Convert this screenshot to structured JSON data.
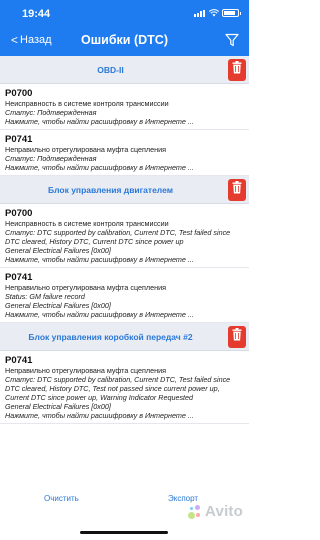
{
  "status_bar": {
    "time": "19:44"
  },
  "nav": {
    "back_label": "Назад",
    "title": "Ошибки (DTC)",
    "filter_icon": "filter-funnel-icon",
    "color": "#1e7cf0"
  },
  "sections": [
    {
      "title": "OBD-II",
      "items": [
        {
          "code": "P0700",
          "desc": "Неисправность в системе контроля трансмиссии",
          "lines": [
            "Статус: Подтвержденная",
            "Нажмите, чтобы найти расшифровку в Интернете ..."
          ]
        },
        {
          "code": "P0741",
          "desc": "Неправильно отрегулирована муфта сцепления",
          "lines": [
            "Статус: Подтвержденная",
            "Нажмите, чтобы найти расшифровку в Интернете ..."
          ]
        }
      ]
    },
    {
      "title": "Блок управления двигателем",
      "items": [
        {
          "code": "P0700",
          "desc": "Неисправность в системе контроля трансмиссии",
          "lines": [
            "Статус: DTC supported by calibration, Current DTC, Test failed since",
            "DTC cleared, History DTC, Current DTC since power up",
            "General Electrical Failures [0x00]",
            "Нажмите, чтобы найти расшифровку в Интернете ..."
          ]
        },
        {
          "code": "P0741",
          "desc": "Неправильно отрегулирована муфта сцепления",
          "lines": [
            "Status: GM failure record",
            "General Electrical Failures [0x00]",
            "Нажмите, чтобы найти расшифровку в Интернете ..."
          ]
        }
      ]
    },
    {
      "title": "Блок управления коробкой передач #2",
      "items": [
        {
          "code": "P0741",
          "desc": "Неправильно отрегулирована муфта сцепления",
          "lines": [
            "Статус: DTC supported by calibration, Current DTC, Test failed since",
            "DTC cleared, History DTC, Test not passed since current power up,",
            "Current DTC since power up, Warning Indicator Requested",
            "General Electrical Failures [0x00]",
            "Нажмите, чтобы найти расшифровку в Интернете ..."
          ]
        }
      ]
    }
  ],
  "footer": {
    "clear_label": "Очистить",
    "export_label": "Экспорт"
  },
  "watermark": {
    "text": "Avito",
    "dot_colors": [
      "#97cf26",
      "#a169f7",
      "#ff6163",
      "#0af"
    ]
  },
  "colors": {
    "accent": "#1e7cf0",
    "link": "#2a78d8",
    "trash": "#e53b2e",
    "section_bg": "#e9edf3"
  }
}
